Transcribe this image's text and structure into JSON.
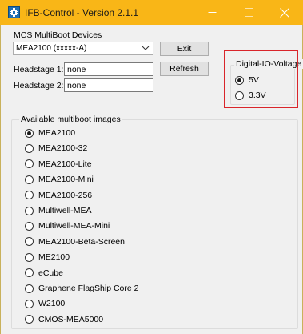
{
  "window": {
    "title": "IFB-Control - Version 2.1.1",
    "minimize_icon": "minimize-icon",
    "maximize_icon": "maximize-icon",
    "close_icon": "close-icon",
    "titlebar_color": "#f9b617"
  },
  "devices": {
    "label": "MCS MultiBoot Devices",
    "selected": "MEA2100 (xxxxx-A)",
    "exit_label": "Exit",
    "refresh_label": "Refresh",
    "headstage1_label": "Headstage 1:",
    "headstage1_value": "none",
    "headstage2_label": "Headstage 2:",
    "headstage2_value": "none"
  },
  "voltage": {
    "title": "Digital-IO-Voltage",
    "options": [
      {
        "label": "5V",
        "checked": true
      },
      {
        "label": "3.3V",
        "checked": false
      }
    ],
    "highlight_color": "#d9252a"
  },
  "images": {
    "title": "Available multiboot images",
    "items": [
      {
        "label": "MEA2100",
        "checked": true
      },
      {
        "label": "MEA2100-32",
        "checked": false
      },
      {
        "label": "MEA2100-Lite",
        "checked": false
      },
      {
        "label": "MEA2100-Mini",
        "checked": false
      },
      {
        "label": "MEA2100-256",
        "checked": false
      },
      {
        "label": "Multiwell-MEA",
        "checked": false
      },
      {
        "label": "Multiwell-MEA-Mini",
        "checked": false
      },
      {
        "label": "MEA2100-Beta-Screen",
        "checked": false
      },
      {
        "label": "ME2100",
        "checked": false
      },
      {
        "label": "eCube",
        "checked": false
      },
      {
        "label": "Graphene FlagShip Core 2",
        "checked": false
      },
      {
        "label": "W2100",
        "checked": false
      },
      {
        "label": "CMOS-MEA5000",
        "checked": false
      }
    ]
  }
}
